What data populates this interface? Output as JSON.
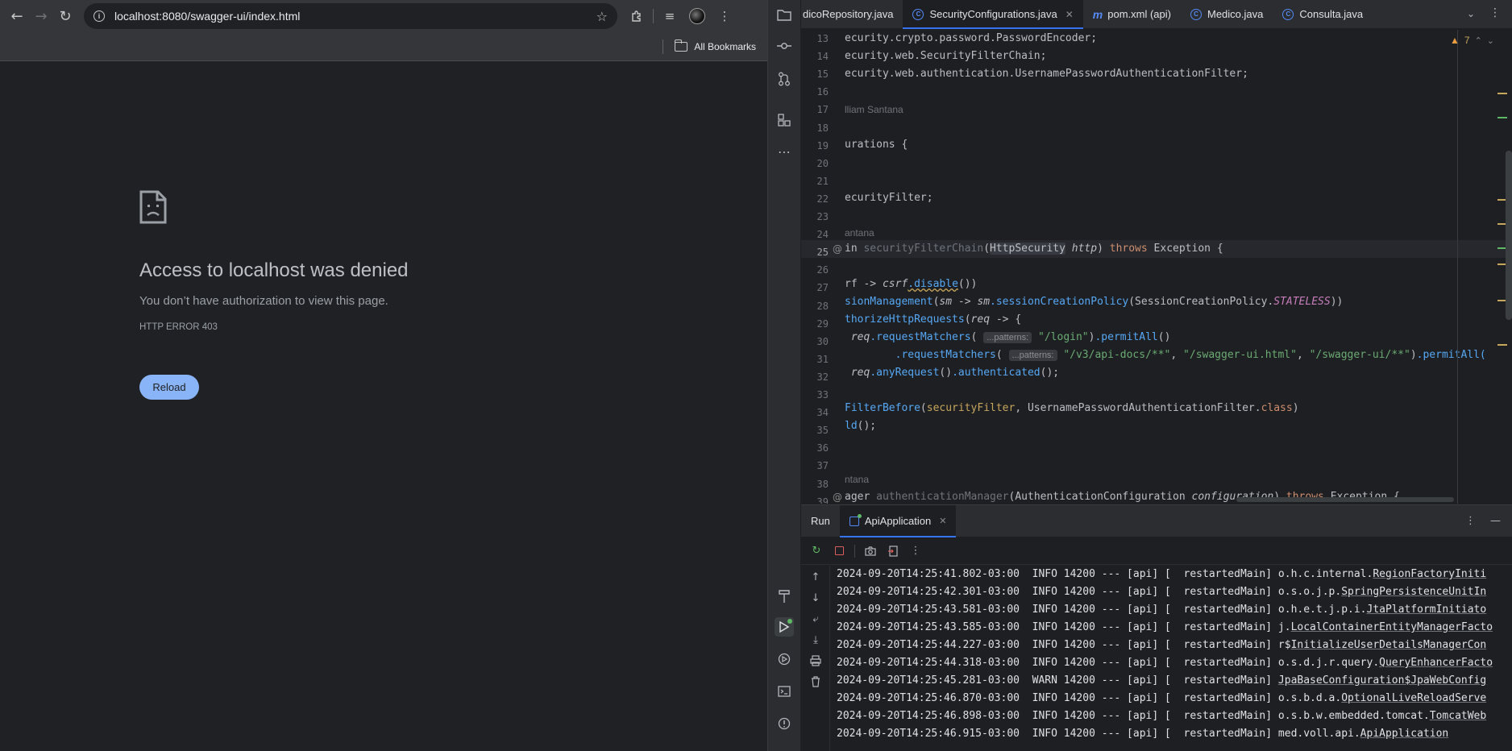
{
  "browser": {
    "url_host": "localhost",
    "url_path": ":8080/swagger-ui/index.html",
    "bookmarks_label": "All Bookmarks",
    "error": {
      "title": "Access to localhost was denied",
      "subtitle": "You don’t have authorization to view this page.",
      "code": "HTTP ERROR 403",
      "reload_label": "Reload"
    }
  },
  "ide": {
    "tabs": [
      {
        "label": "dicoRepository.java"
      },
      {
        "label": "SecurityConfigurations.java",
        "active": true
      },
      {
        "label": "pom.xml (api)"
      },
      {
        "label": "Medico.java"
      },
      {
        "label": "Consulta.java"
      }
    ],
    "warnings_count": "7",
    "line_numbers": [
      "13",
      "14",
      "15",
      "16",
      "17",
      "18",
      "19",
      "20",
      "21",
      "22",
      "23",
      "24",
      "25",
      "26",
      "27",
      "28",
      "29",
      "30",
      "31",
      "32",
      "33",
      "34",
      "35",
      "36",
      "37",
      "38",
      "39"
    ],
    "hints": {
      "line17": "lliam Santana",
      "line24": "antana",
      "line38": "ntana",
      "patterns": "...patterns:"
    },
    "code": {
      "l13": "ecurity.crypto.password.PasswordEncoder;",
      "l14": "ecurity.web.SecurityFilterChain;",
      "l15": "ecurity.web.authentication.UsernamePasswordAuthenticationFilter;",
      "l19a": "urations",
      "l22a": "ecurityFilter",
      "l25_in": "in",
      "l25_m": "securityFilterChain",
      "l25_cls": "HttpSecurity",
      "l25_param": "http",
      "l25_throws": "throws",
      "l25_exc": "Exception",
      "l27a": "rf -> ",
      "l27b": "csrf",
      "l27c": ".disable",
      "l28a": "sionManagement",
      "l28b": "sm",
      "l28c": "sm",
      "l28d": ".sessionCreationPolicy",
      "l28e": "SessionCreationPolicy",
      "l28f": "STATELESS",
      "l29a": "thorizeHttpRequests",
      "l29b": "req",
      "l30a": "req",
      "l30b": ".requestMatchers",
      "l30c": "\"/login\"",
      "l30d": ".permitAll",
      "l31a": ".requestMatchers",
      "l31b": "\"/v3/api-docs/**\"",
      "l31c": "\"/swagger-ui.html\"",
      "l31d": "\"/swagger-ui/**\"",
      "l31e": ".permitAll(",
      "l32a": "req",
      "l32b": ".anyRequest",
      "l32c": ".authenticated",
      "l34a": "FilterBefore",
      "l34b": "securityFilter",
      "l34c": "UsernamePasswordAuthenticationFilter",
      "l34d": "class",
      "l35a": "ld",
      "l39a": "ager",
      "l39b": "authenticationManager",
      "l39c": "AuthenticationConfiguration",
      "l39d": "configuration",
      "l39e": "throws",
      "l39f": "Exception"
    },
    "run": {
      "title": "Run",
      "tab_label": "ApiApplication"
    },
    "logs": [
      {
        "ts": "2024-09-20T14:25:41.802-03:00",
        "level": "INFO",
        "pid": "14200",
        "app": "api",
        "thread": "restartedMain",
        "pkg": "o.h.c.internal.",
        "src": "RegionFactoryIniti"
      },
      {
        "ts": "2024-09-20T14:25:42.301-03:00",
        "level": "INFO",
        "pid": "14200",
        "app": "api",
        "thread": "restartedMain",
        "pkg": "o.s.o.j.p.",
        "src": "SpringPersistenceUnitIn"
      },
      {
        "ts": "2024-09-20T14:25:43.581-03:00",
        "level": "INFO",
        "pid": "14200",
        "app": "api",
        "thread": "restartedMain",
        "pkg": "o.h.e.t.j.p.i.",
        "src": "JtaPlatformInitiato"
      },
      {
        "ts": "2024-09-20T14:25:43.585-03:00",
        "level": "INFO",
        "pid": "14200",
        "app": "api",
        "thread": "restartedMain",
        "pkg": "j.",
        "src": "LocalContainerEntityManagerFacto"
      },
      {
        "ts": "2024-09-20T14:25:44.227-03:00",
        "level": "INFO",
        "pid": "14200",
        "app": "api",
        "thread": "restartedMain",
        "pkg": "r$",
        "src": "InitializeUserDetailsManagerCon"
      },
      {
        "ts": "2024-09-20T14:25:44.318-03:00",
        "level": "INFO",
        "pid": "14200",
        "app": "api",
        "thread": "restartedMain",
        "pkg": "o.s.d.j.r.query.",
        "src": "QueryEnhancerFacto"
      },
      {
        "ts": "2024-09-20T14:25:45.281-03:00",
        "level": "WARN",
        "pid": "14200",
        "app": "api",
        "thread": "restartedMain",
        "pkg": "",
        "src": "JpaBaseConfiguration$JpaWebConfig"
      },
      {
        "ts": "2024-09-20T14:25:46.870-03:00",
        "level": "INFO",
        "pid": "14200",
        "app": "api",
        "thread": "restartedMain",
        "pkg": "o.s.b.d.a.",
        "src": "OptionalLiveReloadServe"
      },
      {
        "ts": "2024-09-20T14:25:46.898-03:00",
        "level": "INFO",
        "pid": "14200",
        "app": "api",
        "thread": "restartedMain",
        "pkg": "o.s.b.w.embedded.tomcat.",
        "src": "TomcatWeb"
      },
      {
        "ts": "2024-09-20T14:25:46.915-03:00",
        "level": "INFO",
        "pid": "14200",
        "app": "api",
        "thread": "restartedMain",
        "pkg": "med.voll.api.",
        "src": "ApiApplication"
      }
    ]
  }
}
